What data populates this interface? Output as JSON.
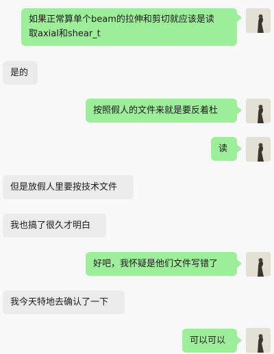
{
  "messages": [
    {
      "side": "out",
      "text_lines": [
        "如果正常算单个beam的拉伸和剪切就应该是读",
        "取axial和shear_t"
      ]
    },
    {
      "side": "in",
      "text": "是的"
    },
    {
      "side": "out",
      "text": "按照假人的文件来就是要反着杜"
    },
    {
      "side": "out",
      "text": "读"
    },
    {
      "side": "in",
      "text": "但是放假人里要按技术文件"
    },
    {
      "side": "in",
      "text": "我也搞了很久才明白"
    },
    {
      "side": "out",
      "text": "好吧，我怀疑是他们文件写错了"
    },
    {
      "side": "in",
      "text": "我今天特地去确认了一下"
    },
    {
      "side": "out",
      "text": "可以可以"
    }
  ],
  "colors": {
    "outgoing_bubble": "#9ded9a",
    "incoming_bubble": "#ebebed",
    "background": "#f8f8fa"
  },
  "avatar": {
    "icon": "user-avatar-icon"
  }
}
